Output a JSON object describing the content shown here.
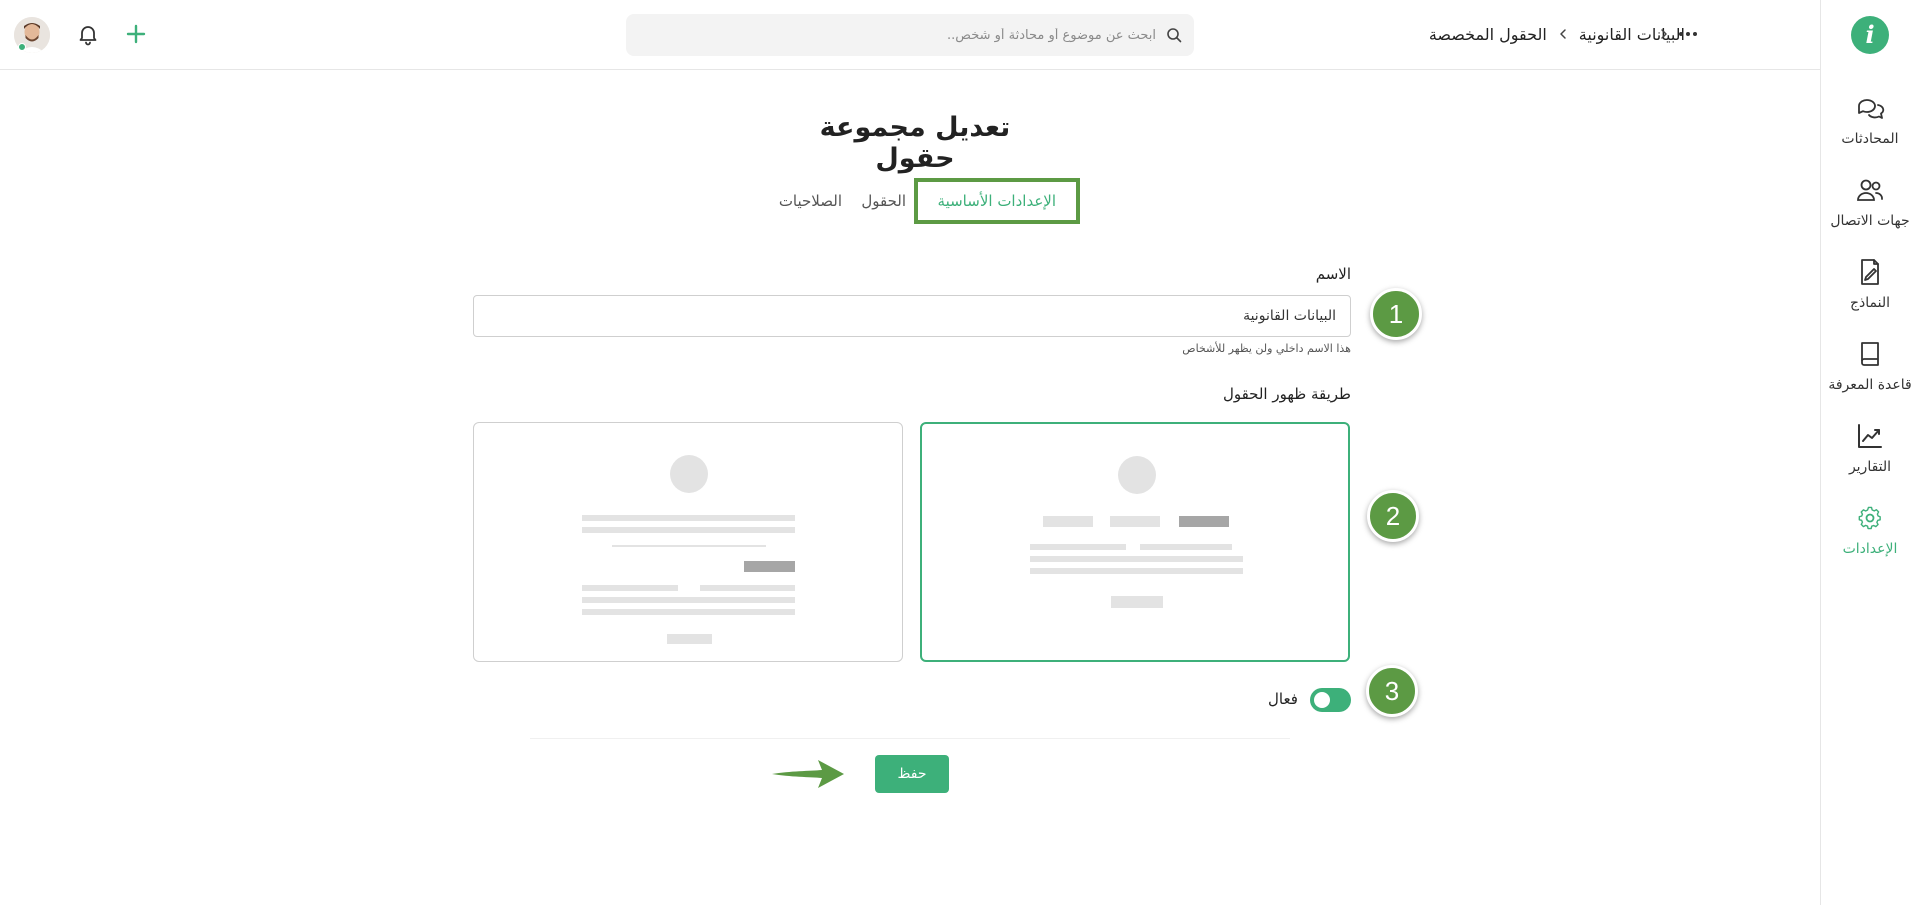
{
  "header": {
    "breadcrumbs": [
      "الحقول المخصصة",
      "البيانات القانونية"
    ],
    "search_placeholder": "ابحث عن موضوع أو محادثة أو شخص..",
    "icons": [
      "more-dots-icon",
      "chevron-left-icon",
      "search-icon",
      "bell-icon",
      "plus-icon"
    ]
  },
  "sidebar": {
    "logo": "i",
    "items": [
      {
        "label": "المحادثات",
        "icon": "chat-icon"
      },
      {
        "label": "جهات الاتصال",
        "icon": "contacts-icon"
      },
      {
        "label": "النماذج",
        "icon": "forms-icon"
      },
      {
        "label": "قاعدة المعرفة",
        "icon": "book-icon"
      },
      {
        "label": "التقارير",
        "icon": "chart-icon"
      },
      {
        "label": "الإعدادات",
        "icon": "gear-icon",
        "active": true
      }
    ]
  },
  "main": {
    "title": "تعديل مجموعة حقول",
    "tabs": [
      {
        "label": "الإعدادات الأساسية",
        "active": true
      },
      {
        "label": "الحقول"
      },
      {
        "label": "الصلاحيات"
      }
    ],
    "name_label": "الاسم",
    "name_value": "البيانات القانونية",
    "name_hint": "هذا الاسم داخلي ولن يظهر للأشخاص",
    "layout_label": "طريقة ظهور الحقول",
    "layout_options": [
      {
        "id": "tabs-layout",
        "selected": true
      },
      {
        "id": "stacked-layout",
        "selected": false
      }
    ],
    "active_label": "فعال",
    "active_on": true,
    "save_label": "حفظ"
  },
  "annotations": [
    "1",
    "2",
    "3"
  ],
  "colors": {
    "accent": "#3db07a",
    "annotation": "#5c9a44",
    "placeholder": "#e3e3e3",
    "placeholder_dark": "#a6a6a6"
  }
}
